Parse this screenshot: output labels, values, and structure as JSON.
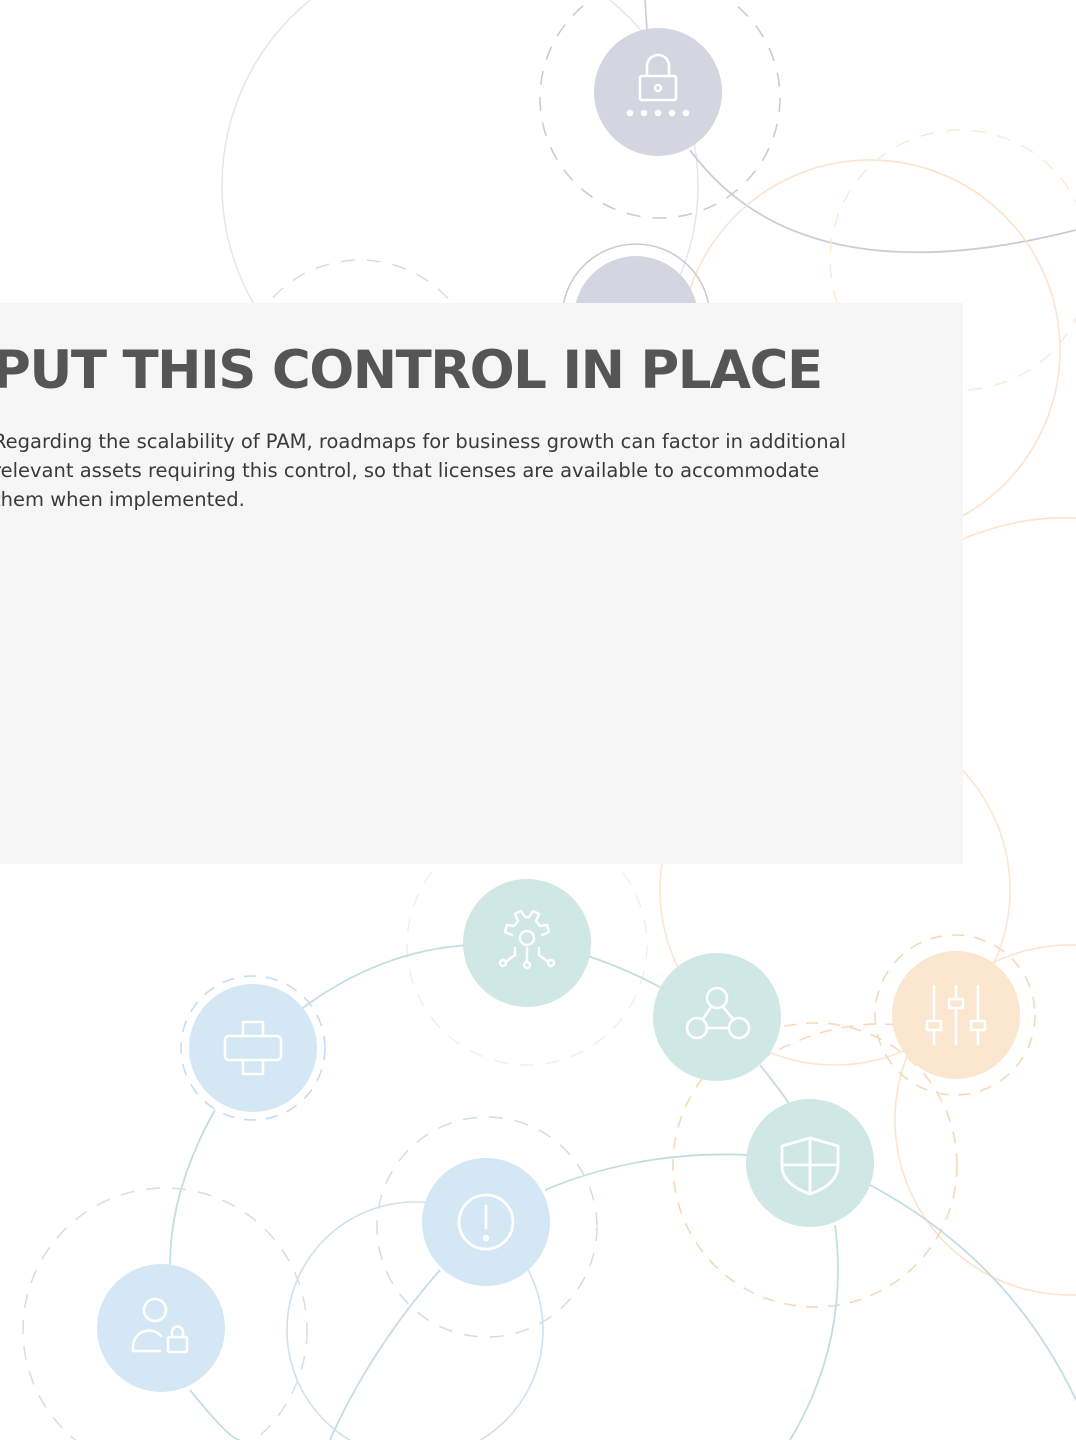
{
  "heading": "PUT THIS CONTROL IN PLACE",
  "body": "Regarding the scalability of PAM, roadmaps for business growth can factor in additional relevant assets requiring this control, so that licenses are available to accommodate them when implemented.",
  "icons": [
    "padlock-password-icon",
    "user-icon",
    "network-gear-icon",
    "puzzle-cross-icon",
    "node-network-icon",
    "sliders-icon",
    "shield-icon",
    "alert-icon",
    "user-lock-icon"
  ],
  "colors": {
    "panel": "#f6f6f6",
    "heading": "#555555",
    "body_text": "#3a3a3a",
    "gray_circle": "#d3d6e0",
    "teal_circle": "#cfe7e5",
    "blue_circle": "#d4e7f4",
    "orange_circle": "#fbe6d0"
  }
}
